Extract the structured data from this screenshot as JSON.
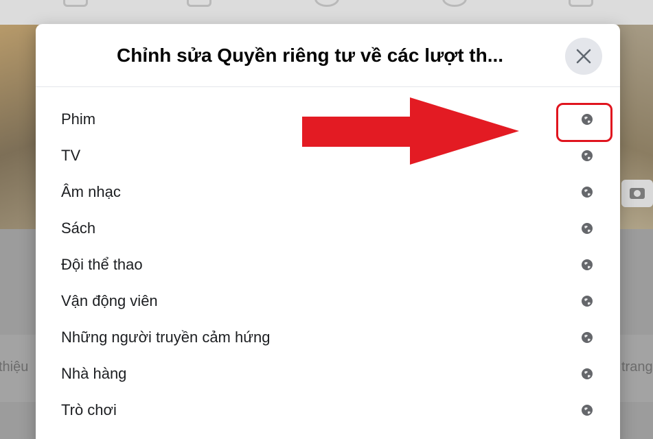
{
  "background": {
    "left_text": "thiệu",
    "right_text": "trang"
  },
  "modal": {
    "title": "Chỉnh sửa Quyền riêng tư về các lượt th...",
    "close_icon": "close-icon",
    "items": [
      {
        "label": "Phim",
        "icon": "globe-icon"
      },
      {
        "label": "TV",
        "icon": "globe-icon"
      },
      {
        "label": "Âm nhạc",
        "icon": "globe-icon"
      },
      {
        "label": "Sách",
        "icon": "globe-icon"
      },
      {
        "label": "Đội thể thao",
        "icon": "globe-icon"
      },
      {
        "label": "Vận động viên",
        "icon": "globe-icon"
      },
      {
        "label": "Những người truyền cảm hứng",
        "icon": "globe-icon"
      },
      {
        "label": "Nhà hàng",
        "icon": "globe-icon"
      },
      {
        "label": "Trò chơi",
        "icon": "globe-icon"
      }
    ]
  },
  "annotation": {
    "arrow_color": "#e31b23",
    "highlight_color": "#e0141e"
  }
}
